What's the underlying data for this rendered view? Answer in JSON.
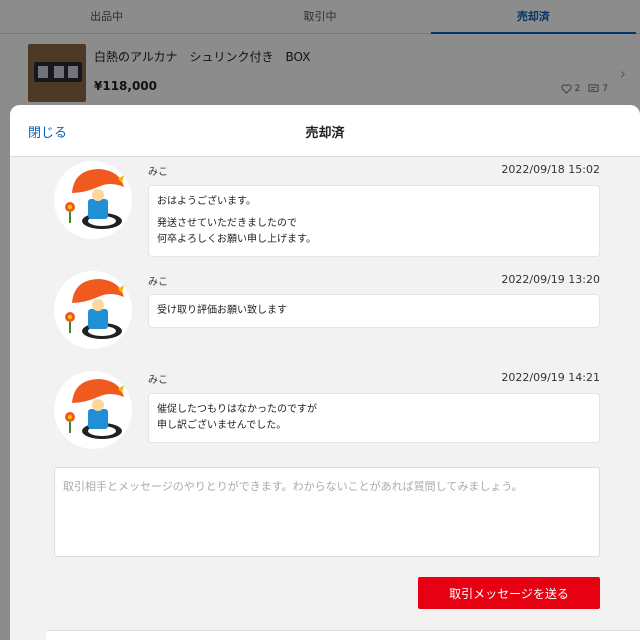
{
  "tabs": [
    {
      "label": "出品中"
    },
    {
      "label": "取引中"
    },
    {
      "label": "売却済"
    }
  ],
  "item": {
    "title": "白熱のアルカナ　シュリンク付き　BOX",
    "price": "¥118,000",
    "likes": "2",
    "comments": "7"
  },
  "sheet": {
    "close_label": "閉じる",
    "title": "売却済"
  },
  "messages": [
    {
      "name": "みこ",
      "time": "2022/09/18 15:02",
      "lines": [
        "おはようございます。",
        "発送させていただきましたので",
        "何卒よろしくお願い申し上げます。"
      ]
    },
    {
      "name": "みこ",
      "time": "2022/09/19 13:20",
      "lines": [
        "受け取り評価お願い致します"
      ]
    },
    {
      "name": "みこ",
      "time": "2022/09/19 14:21",
      "lines": [
        "催促したつもりはなかったのですが",
        "申し訳ございませんでした。"
      ]
    }
  ],
  "compose": {
    "placeholder": "取引相手とメッセージのやりとりができます。わからないことがあれば質問してみましょう。",
    "send_label": "取引メッセージを送る"
  },
  "colors": {
    "accent": "#0b5fb8",
    "send": "#e60012"
  }
}
